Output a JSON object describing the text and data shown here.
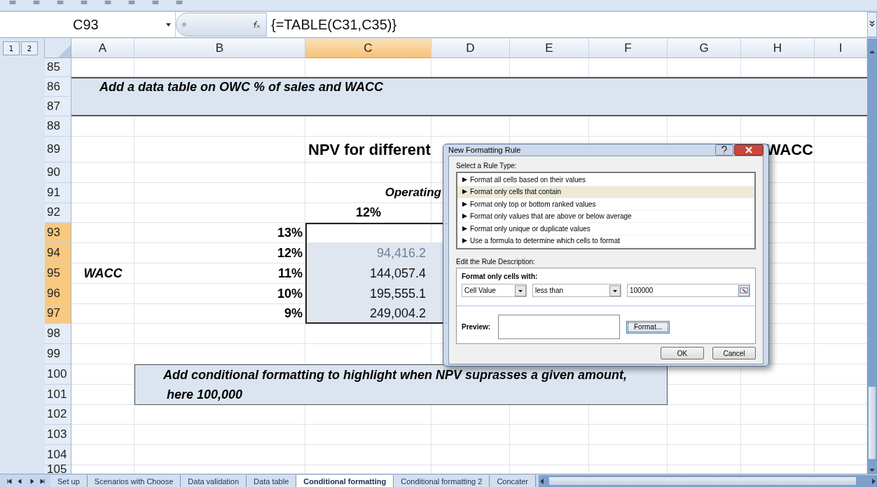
{
  "formula_bar": {
    "name_box": "C93",
    "formula": "{=TABLE(C31,C35)}"
  },
  "outline_levels": [
    "1",
    "2"
  ],
  "columns": [
    {
      "label": "A",
      "selected": false
    },
    {
      "label": "B",
      "selected": false
    },
    {
      "label": "C",
      "selected": true
    },
    {
      "label": "D",
      "selected": false
    },
    {
      "label": "E",
      "selected": false
    },
    {
      "label": "F",
      "selected": false
    },
    {
      "label": "G",
      "selected": false
    },
    {
      "label": "H",
      "selected": false
    },
    {
      "label": "I",
      "selected": false
    }
  ],
  "rows": [
    {
      "label": "85",
      "selected": false
    },
    {
      "label": "86",
      "selected": false
    },
    {
      "label": "87",
      "selected": false
    },
    {
      "label": "88",
      "selected": false
    },
    {
      "label": "89",
      "selected": false
    },
    {
      "label": "90",
      "selected": false
    },
    {
      "label": "91",
      "selected": false
    },
    {
      "label": "92",
      "selected": false
    },
    {
      "label": "93",
      "selected": true
    },
    {
      "label": "94",
      "selected": true
    },
    {
      "label": "95",
      "selected": true
    },
    {
      "label": "96",
      "selected": true
    },
    {
      "label": "97",
      "selected": true
    },
    {
      "label": "98",
      "selected": false
    },
    {
      "label": "99",
      "selected": false
    },
    {
      "label": "100",
      "selected": false
    },
    {
      "label": "101",
      "selected": false
    },
    {
      "label": "102",
      "selected": false
    },
    {
      "label": "103",
      "selected": false
    },
    {
      "label": "104",
      "selected": false
    },
    {
      "label": "105",
      "selected": false
    }
  ],
  "instruction_note": "Add a data table on OWC % of sales and WACC",
  "data_table": {
    "title": "NPV for different",
    "title_end": "WACC",
    "header": "Operating",
    "column_value": "12%",
    "axis_label": "WACC",
    "rows": [
      {
        "rate": "13%"
      },
      {
        "rate": "12%",
        "value": "94,416.2",
        "highlighted": true
      },
      {
        "rate": "11%",
        "value": "144,057.4",
        "highlighted": false
      },
      {
        "rate": "10%",
        "value": "195,555.1",
        "highlighted": false
      },
      {
        "rate": "9%",
        "value": "249,004.2",
        "highlighted": false
      }
    ]
  },
  "task_note": [
    "Add conditional formatting to highlight when NPV suprasses a given amount,",
    "here 100,000"
  ],
  "dialog": {
    "title": "New Formatting Rule",
    "rule_type_label": "Select a Rule Type:",
    "rule_types": [
      {
        "label": "Format all cells based on their values",
        "selected": false
      },
      {
        "label": "Format only cells that contain",
        "selected": true
      },
      {
        "label": "Format only top or bottom ranked values",
        "selected": false
      },
      {
        "label": "Format only values that are above or below average",
        "selected": false
      },
      {
        "label": "Format only unique or duplicate values",
        "selected": false
      },
      {
        "label": "Use a formula to determine which cells to format",
        "selected": false
      }
    ],
    "description_label": "Edit the Rule Description:",
    "condition_heading": "Format only cells with:",
    "condition_field": "Cell Value",
    "operator": "less than",
    "value": "100000",
    "preview_label": "Preview:",
    "format_button": "Format...",
    "buttons": [
      "OK",
      "Cancel"
    ]
  },
  "sheet_tabs": [
    {
      "label": "Set up",
      "selected": false
    },
    {
      "label": "Scenarios with Choose",
      "selected": false
    },
    {
      "label": "Data validation",
      "selected": false
    },
    {
      "label": "Data table",
      "selected": false
    },
    {
      "label": "Conditional formatting",
      "selected": true
    },
    {
      "label": "Conditional formatting 2",
      "selected": false
    },
    {
      "label": "Concater",
      "selected": false
    }
  ]
}
